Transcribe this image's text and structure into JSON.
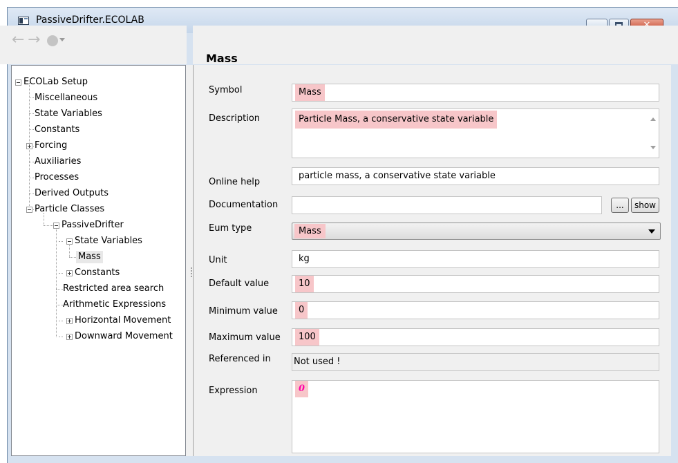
{
  "window": {
    "title": "PassiveDrifter.ECOLAB",
    "controls": {
      "minimize": "minimize",
      "maximize": "maximize",
      "close": "✕"
    }
  },
  "toolbar": {
    "back_icon": "←",
    "forward_icon": "→"
  },
  "header": {
    "title": "Mass"
  },
  "tree": {
    "root": "ECOLab Setup",
    "items": {
      "misc": "Miscellaneous",
      "state_vars": "State Variables",
      "constants": "Constants",
      "forcing": "Forcing",
      "auxiliaries": "Auxiliaries",
      "processes": "Processes",
      "derived": "Derived Outputs",
      "particle_classes": "Particle Classes",
      "passive_drifter": "PassiveDrifter",
      "pd_state_vars": "State Variables",
      "mass": "Mass",
      "pd_constants": "Constants",
      "restricted": "Restricted area search",
      "arith": "Arithmetic Expressions",
      "horizontal": "Horizontal Movement",
      "downward": "Downward Movement"
    }
  },
  "form": {
    "symbol": {
      "label": "Symbol",
      "value": "Mass"
    },
    "description": {
      "label": "Description",
      "value": "Particle Mass, a conservative state variable"
    },
    "online_help": {
      "label": "Online help",
      "value": "particle mass, a conservative state variable"
    },
    "documentation": {
      "label": "Documentation",
      "value": "",
      "browse_label": "...",
      "show_label": "show"
    },
    "eum_type": {
      "label": "Eum type",
      "value": "Mass"
    },
    "unit": {
      "label": "Unit",
      "value": "kg"
    },
    "default_value": {
      "label": "Default value",
      "value": "10"
    },
    "minimum_value": {
      "label": "Minimum value",
      "value": "0"
    },
    "maximum_value": {
      "label": "Maximum value",
      "value": "100"
    },
    "referenced_in": {
      "label": "Referenced in",
      "value": "Not used !"
    },
    "expression": {
      "label": "Expression",
      "value": "0"
    }
  },
  "colors": {
    "highlight": "#f7c6c9",
    "expression": "#ff00a8",
    "title_bar": "#c5d6ea",
    "panel": "#f0f0f0"
  }
}
